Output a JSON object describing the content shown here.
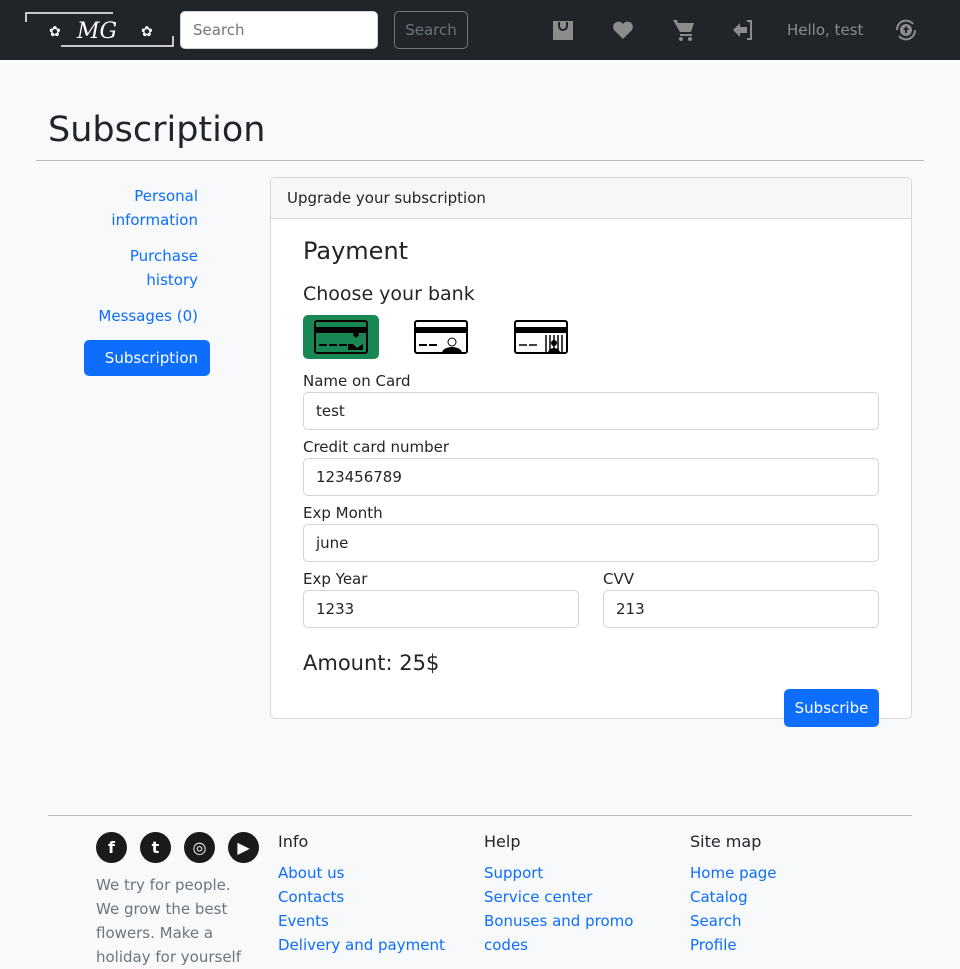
{
  "nav": {
    "logo_text": "MG",
    "search_placeholder": "Search",
    "search_button": "Search",
    "greeting": "Hello, test"
  },
  "page_title": "Subscription",
  "sidebar": {
    "items": [
      {
        "label": "Personal information"
      },
      {
        "label": "Purchase history"
      },
      {
        "label": "Messages (0)"
      },
      {
        "label": "Subscription"
      }
    ]
  },
  "card": {
    "header": "Upgrade your subscription",
    "payment_title": "Payment",
    "choose_bank": "Choose your bank",
    "banks": [
      {
        "name": "charity-card",
        "selected": true
      },
      {
        "name": "elderly-card",
        "selected": false
      },
      {
        "name": "prison-card",
        "selected": false
      }
    ],
    "fields": {
      "name_label": "Name on Card",
      "name_value": "test",
      "card_label": "Credit card number",
      "card_value": "123456789",
      "month_label": "Exp Month",
      "month_value": "june",
      "year_label": "Exp Year",
      "year_value": "1233",
      "cvv_label": "CVV",
      "cvv_value": "213"
    },
    "amount": "Amount: 25$",
    "subscribe": "Subscribe",
    "accent": "#198754"
  },
  "footer": {
    "about": "We try for people. We grow the best flowers. Make a holiday for yourself",
    "info": {
      "title": "Info",
      "links": [
        "About us",
        "Contacts",
        "Events",
        "Delivery and payment"
      ]
    },
    "help": {
      "title": "Help",
      "links": [
        "Support",
        "Service center",
        "Bonuses and promo codes"
      ]
    },
    "sitemap": {
      "title": "Site map",
      "links": [
        "Home page",
        "Catalog",
        "Search",
        "Profile"
      ]
    }
  }
}
